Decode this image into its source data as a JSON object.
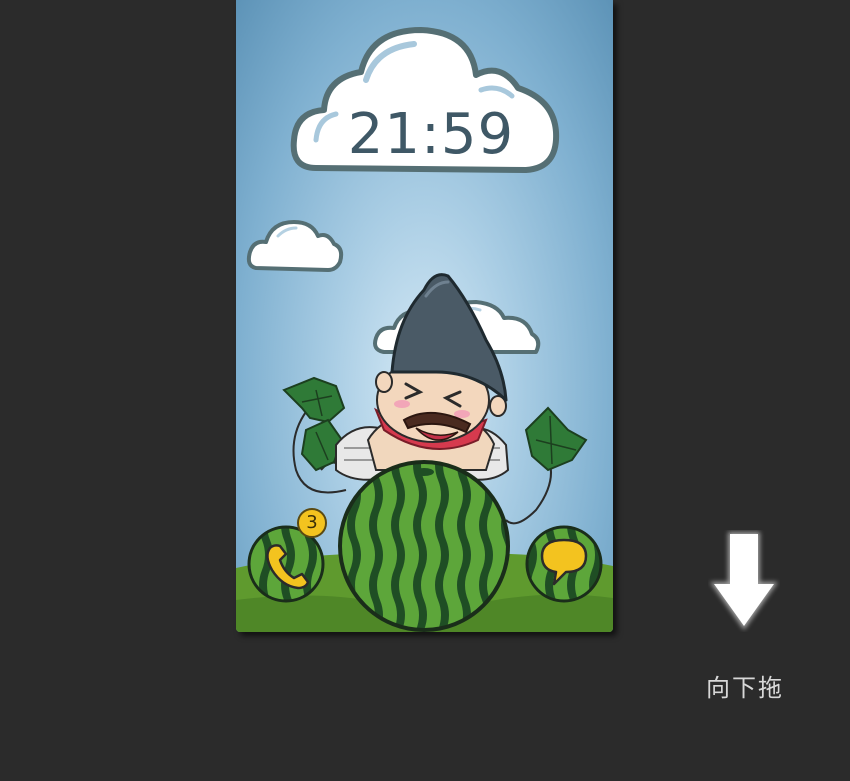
{
  "lockscreen": {
    "time": "21:59",
    "phone_badge_count": "3",
    "drag_hint": "向下拖"
  },
  "icons": {
    "phone_shortcut": "phone-handset-icon",
    "message_shortcut": "speech-bubble-icon",
    "unlock": "watermelon-icon",
    "drag_direction": "arrow-down-icon"
  },
  "colors": {
    "background": "#2b2b2b",
    "sky_light": "#d6eaf6",
    "sky_dark": "#5d93b7",
    "grass": "#5f9a2e",
    "melon_dark": "#1e4b24",
    "melon_light": "#4f9a35",
    "badge": "#f3c31f"
  }
}
